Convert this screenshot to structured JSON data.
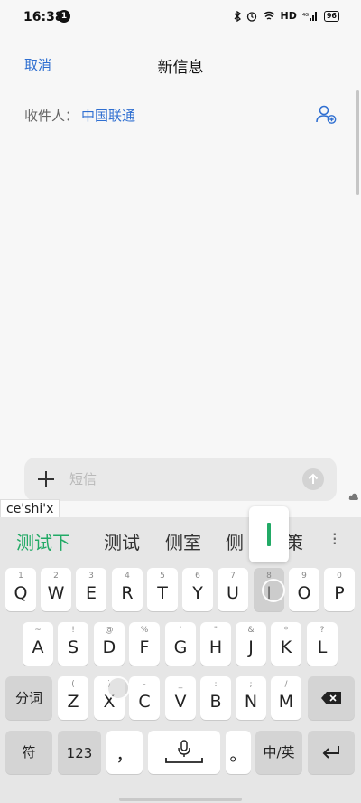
{
  "status_bar": {
    "time": "16:38",
    "notification_count": "1",
    "network": "HD",
    "signal": "4G",
    "battery": "96"
  },
  "header": {
    "cancel_label": "取消",
    "title": "新信息"
  },
  "recipient": {
    "label": "收件人：",
    "value": "中国联通"
  },
  "compose": {
    "placeholder": "短信",
    "composition_text": "ce'shi'x"
  },
  "keyboard": {
    "candidates": [
      "测试下",
      "测试",
      "侧室",
      "侧",
      "策"
    ],
    "more_label": "⁝",
    "row1": [
      {
        "main": "Q",
        "hint": "1"
      },
      {
        "main": "W",
        "hint": "2"
      },
      {
        "main": "E",
        "hint": "3"
      },
      {
        "main": "R",
        "hint": "4"
      },
      {
        "main": "T",
        "hint": "5"
      },
      {
        "main": "Y",
        "hint": "6"
      },
      {
        "main": "U",
        "hint": "7"
      },
      {
        "main": "I",
        "hint": "8"
      },
      {
        "main": "O",
        "hint": "9"
      },
      {
        "main": "P",
        "hint": "0"
      }
    ],
    "row2": [
      {
        "main": "A",
        "hint": "~"
      },
      {
        "main": "S",
        "hint": "!"
      },
      {
        "main": "D",
        "hint": "@"
      },
      {
        "main": "F",
        "hint": "%"
      },
      {
        "main": "G",
        "hint": "'"
      },
      {
        "main": "H",
        "hint": "\""
      },
      {
        "main": "J",
        "hint": "&"
      },
      {
        "main": "K",
        "hint": "*"
      },
      {
        "main": "L",
        "hint": "?"
      }
    ],
    "row3": [
      {
        "main": "Z",
        "hint": "("
      },
      {
        "main": "X",
        "hint": ")"
      },
      {
        "main": "C",
        "hint": "-"
      },
      {
        "main": "V",
        "hint": "_"
      },
      {
        "main": "B",
        "hint": ":"
      },
      {
        "main": "N",
        "hint": ";"
      },
      {
        "main": "M",
        "hint": "/"
      }
    ],
    "fenci_label": "分词",
    "symbol_label": "符",
    "num_label": "123",
    "comma_label": "，",
    "period_label": "。",
    "lang_label": "中/英",
    "accent_color": "#22aa66"
  }
}
